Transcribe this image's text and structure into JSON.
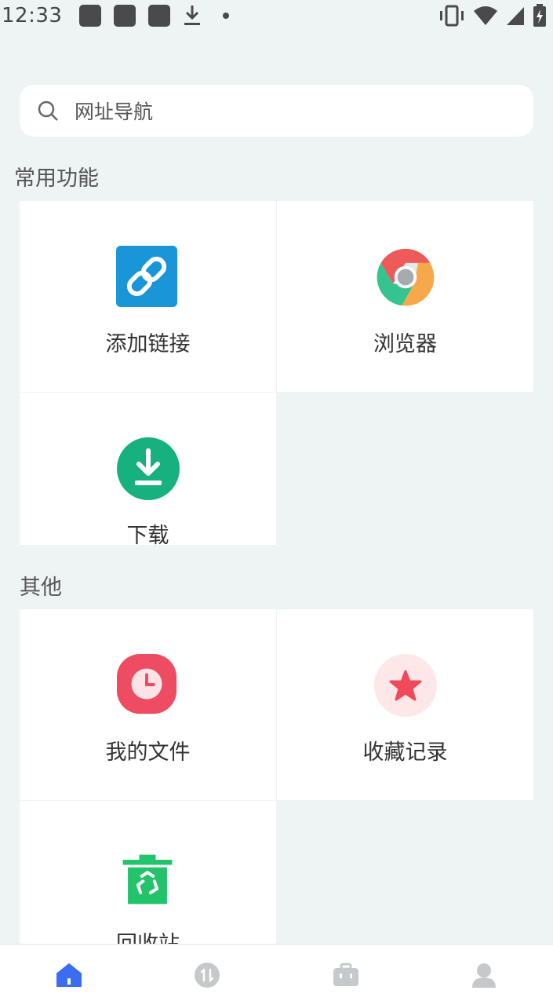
{
  "status_bar": {
    "time": "12:33",
    "icons": [
      "notification-app-icon",
      "notification-app-icon",
      "notification-app-icon",
      "download-icon",
      "dot-icon",
      "vibrate-icon",
      "wifi-icon",
      "signal-icon",
      "battery-charging-icon"
    ]
  },
  "search": {
    "placeholder": "网址导航"
  },
  "sections": [
    {
      "title": "常用功能",
      "items": [
        {
          "label": "添加链接",
          "icon": "link-icon"
        },
        {
          "label": "浏览器",
          "icon": "browser-icon"
        },
        {
          "label": "下载",
          "icon": "download-icon"
        }
      ]
    },
    {
      "title": "其他",
      "items": [
        {
          "label": "我的文件",
          "icon": "clock-icon"
        },
        {
          "label": "收藏记录",
          "icon": "star-icon"
        },
        {
          "label": "回收站",
          "icon": "recycle-bin-icon"
        }
      ]
    }
  ],
  "bottom_nav": [
    {
      "name": "home",
      "icon": "home-icon",
      "active": true
    },
    {
      "name": "transfer",
      "icon": "transfer-icon",
      "active": false
    },
    {
      "name": "toolbox",
      "icon": "toolbox-icon",
      "active": false
    },
    {
      "name": "profile",
      "icon": "profile-icon",
      "active": false
    }
  ],
  "colors": {
    "background": "#eef3f3",
    "accent": "#3b6df0",
    "link_icon_bg": "#1a96d8",
    "download_green": "#17b07f",
    "file_red": "#ee4c63",
    "star_red": "#f04a5a",
    "recycle_green": "#22c36b",
    "nav_inactive": "#c6c9cc"
  }
}
